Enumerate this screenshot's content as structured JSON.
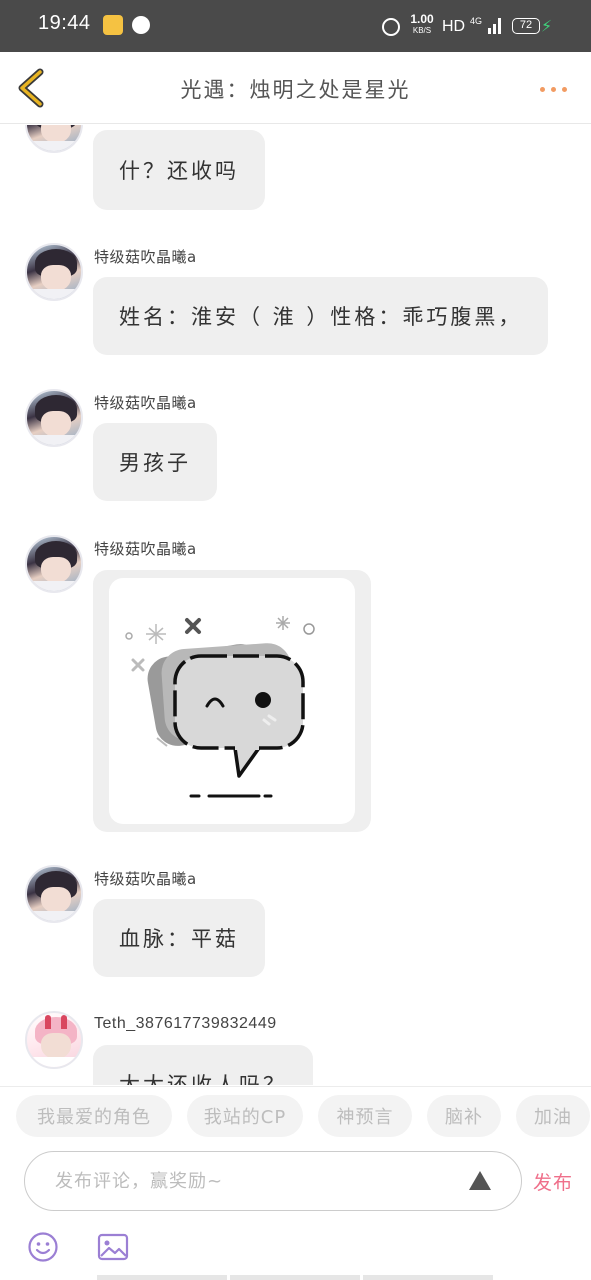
{
  "status_bar": {
    "time": "19:44",
    "speed_value": "1.00",
    "speed_unit": "KB/S",
    "hd": "HD",
    "network": "4G",
    "battery": "72"
  },
  "header": {
    "title": "光遇：烛明之处是星光"
  },
  "messages": [
    {
      "id": "m0",
      "user": "",
      "text": "什？还收吗"
    },
    {
      "id": "m1",
      "user": "特级菇吹晶曦a",
      "text": "姓名：淮安（ 淮 ）性格：乖巧腹黑，"
    },
    {
      "id": "m2",
      "user": "特级菇吹晶曦a",
      "text": "男孩子"
    },
    {
      "id": "m3",
      "user": "特级菇吹晶曦a",
      "text": ""
    },
    {
      "id": "m4",
      "user": "特级菇吹晶曦a",
      "text": "血脉：平菇"
    },
    {
      "id": "m5",
      "user": "Teth_387617739832449",
      "text": "太太还收人吗？"
    }
  ],
  "chips": [
    "我最爱的角色",
    "我站的CP",
    "神预言",
    "脑补",
    "加油"
  ],
  "composer": {
    "placeholder": "发布评论，赢奖励~",
    "publish_label": "发布"
  },
  "colors": {
    "accent_pink": "#ef6f8a",
    "more_orange": "#f29b62",
    "back_yellow": "#e8b422",
    "icon_purple": "#9b7fd4"
  }
}
